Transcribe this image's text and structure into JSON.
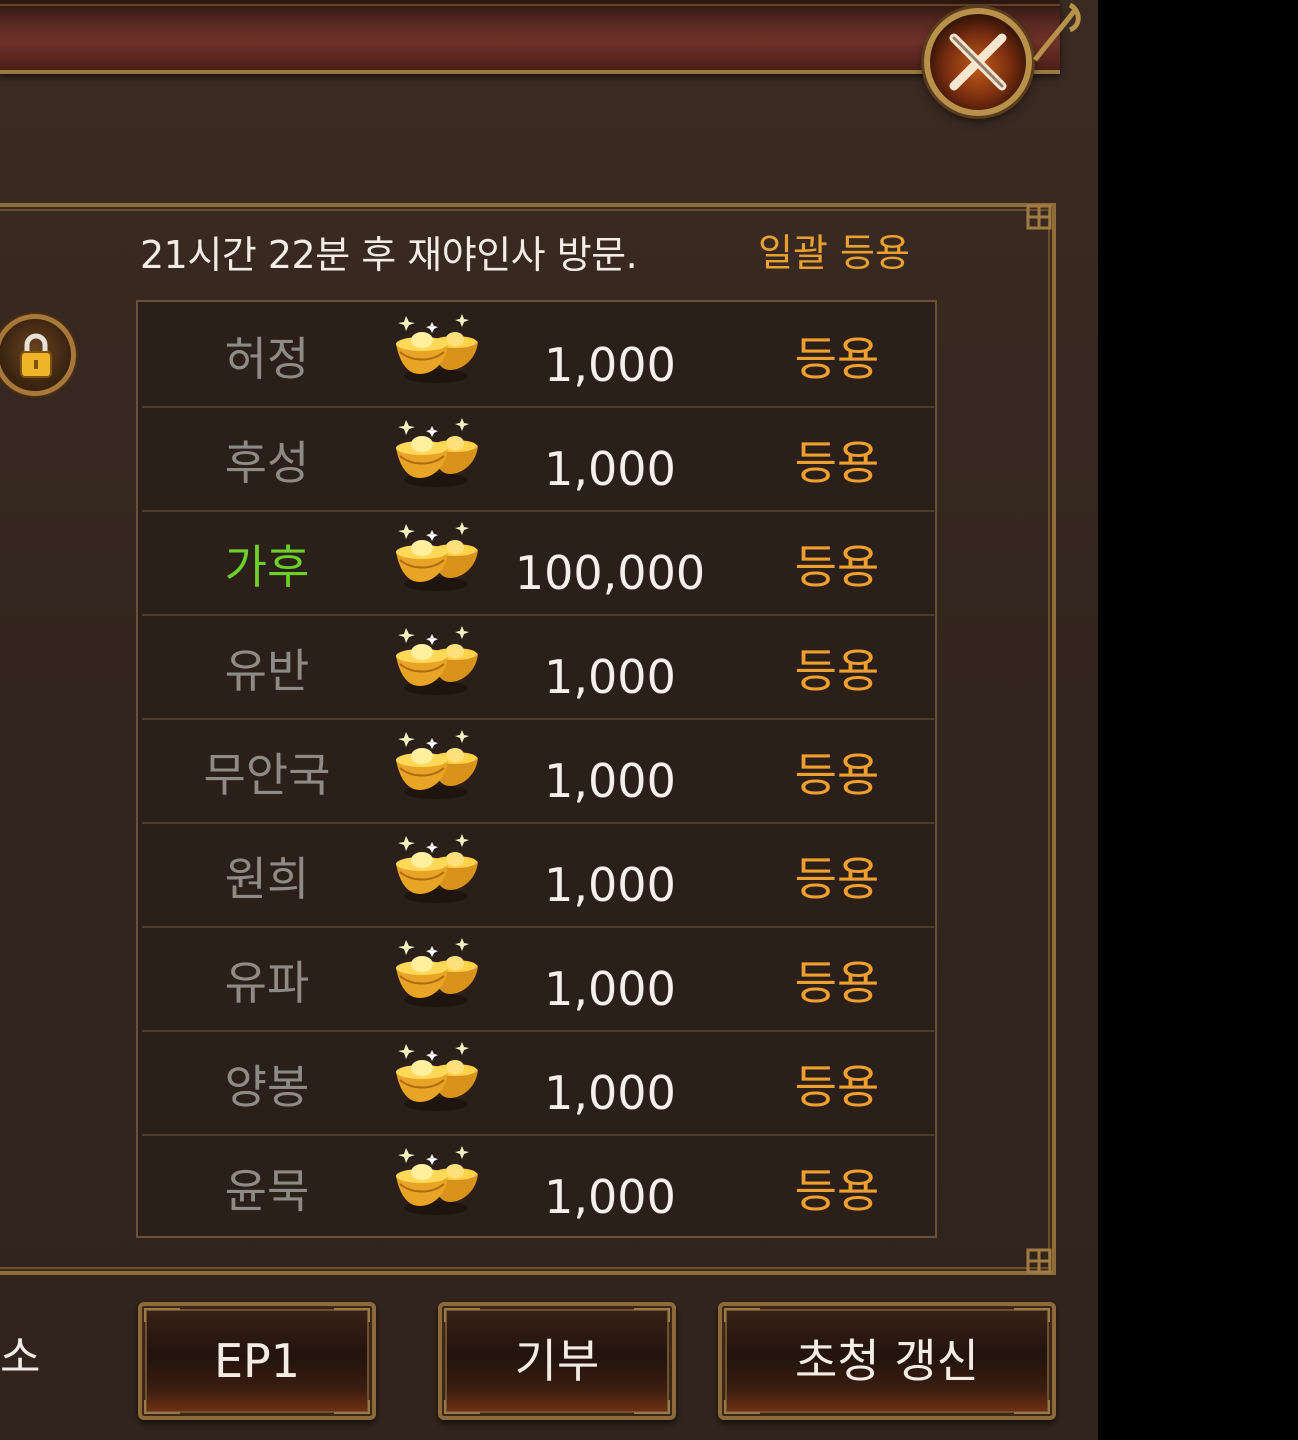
{
  "header": {
    "timer_text": "21시간 22분 후 재야인사 방문.",
    "bulk_register_label": "일괄 등용"
  },
  "rows": [
    {
      "name": "허정",
      "amount": "1,000",
      "action": "등용",
      "highlight": false
    },
    {
      "name": "후성",
      "amount": "1,000",
      "action": "등용",
      "highlight": false
    },
    {
      "name": "가후",
      "amount": "100,000",
      "action": "등용",
      "highlight": true
    },
    {
      "name": "유반",
      "amount": "1,000",
      "action": "등용",
      "highlight": false
    },
    {
      "name": "무안국",
      "amount": "1,000",
      "action": "등용",
      "highlight": false
    },
    {
      "name": "원희",
      "amount": "1,000",
      "action": "등용",
      "highlight": false
    },
    {
      "name": "유파",
      "amount": "1,000",
      "action": "등용",
      "highlight": false
    },
    {
      "name": "양봉",
      "amount": "1,000",
      "action": "등용",
      "highlight": false
    },
    {
      "name": "윤묵",
      "amount": "1,000",
      "action": "등용",
      "highlight": false
    }
  ],
  "footer": {
    "left_partial_label": "소",
    "ep1_label": "EP1",
    "donate_label": "기부",
    "invite_refresh_label": "초청 갱신"
  },
  "icons": {
    "close": "close-x-icon",
    "lock": "lock-icon",
    "currency": "gold-ingot-icon"
  },
  "colors": {
    "accent_orange": "#ee9f30",
    "highlight_green": "#6ccf2a",
    "frame_gold": "#8f6d3a"
  }
}
